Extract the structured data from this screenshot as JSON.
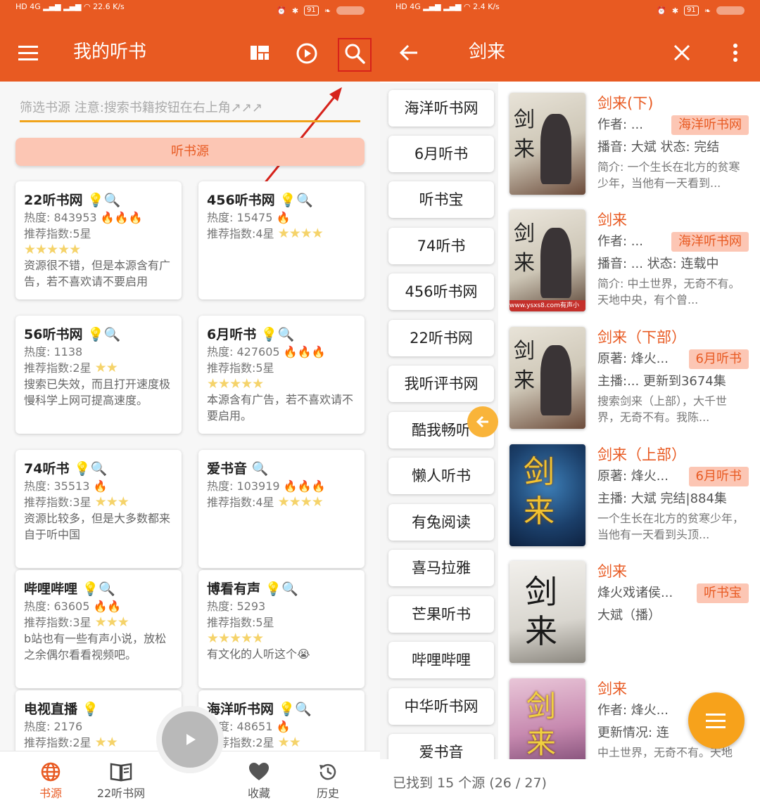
{
  "status_left": {
    "net1": "HD 4G",
    "net2": "HD 4G",
    "speed_left": "22.6",
    "speed_right": "2.4",
    "unit": "K/s"
  },
  "status_right": {
    "battery": "91"
  },
  "left": {
    "title": "我的听书",
    "filter_placeholder": "筛选书源 注意:搜索书籍按钮在右上角↗↗↗",
    "source_button": "听书源",
    "cards": [
      {
        "name": "22听书网",
        "heat": "热度: 843953",
        "rec": "推荐指数:5星",
        "stars": "★★★★★",
        "desc": "资源很不错，但是本源含有广告，若不喜欢请不要启用"
      },
      {
        "name": "456听书网",
        "heat": "热度: 15475",
        "rec": "推荐指数:4星",
        "stars": "★★★★",
        "desc": ""
      },
      {
        "name": "56听书网",
        "heat": "热度: 1138",
        "rec": "推荐指数:2星",
        "stars": "★★",
        "desc": "搜索已失效，而且打开速度极慢科学上网可提高速度。"
      },
      {
        "name": "6月听书",
        "heat": "热度: 427605",
        "rec": "推荐指数:5星",
        "stars": "★★★★★",
        "desc": "本源含有广告，若不喜欢请不要启用。"
      },
      {
        "name": "74听书",
        "heat": "热度: 35513",
        "rec": "推荐指数:3星",
        "stars": "★★★",
        "desc": "资源比较多，但是大多数都来自于听中国"
      },
      {
        "name": "爱书音",
        "heat": "热度: 103919",
        "rec": "推荐指数:4星",
        "stars": "★★★★",
        "desc": ""
      },
      {
        "name": "哔哩哔哩",
        "heat": "热度: 63605",
        "rec": "推荐指数:3星",
        "stars": "★★★",
        "desc": "b站也有一些有声小说，放松之余偶尔看看视频吧。"
      },
      {
        "name": "博看有声",
        "heat": "热度: 5293",
        "rec": "推荐指数:5星",
        "stars": "★★★★★",
        "desc": "有文化的人听这个😭"
      },
      {
        "name": "电视直播",
        "heat": "热度: 2176",
        "rec": "推荐指数:2星",
        "stars": "★★",
        "desc": ""
      },
      {
        "name": "海洋听书网",
        "heat": "热度: 48651",
        "rec": "推荐指数:2星",
        "stars": "★★",
        "desc": ""
      }
    ],
    "nav": [
      {
        "label": "书源",
        "icon": "globe-icon"
      },
      {
        "label": "22听书网",
        "icon": "book-icon"
      },
      {
        "label": "收藏",
        "icon": "heart-icon"
      },
      {
        "label": "历史",
        "icon": "history-icon"
      }
    ]
  },
  "right": {
    "title": "剑来",
    "sources": [
      "海洋听书网",
      "6月听书",
      "听书宝",
      "74听书",
      "456听书网",
      "22听书网",
      "我听评书网",
      "酷我畅听",
      "懒人听书",
      "有兔阅读",
      "喜马拉雅",
      "芒果听书",
      "哔哩哔哩",
      "中华听书网",
      "爱书音"
    ],
    "books": [
      {
        "title": "剑来(下)",
        "line1": "作者: ...",
        "tag": "海洋听书网",
        "line2": "播音: 大斌   状态:  完结",
        "desc": "简介:  一个生长在北方的贫寒少年，当他有一天看到..."
      },
      {
        "title": "剑来",
        "line1": "作者: ...",
        "tag": "海洋听书网",
        "line2": "播音: ...   状态:  连载中",
        "desc": "简介:  中土世界，无奇不有。天地中央，有个曾..."
      },
      {
        "title": "剑来（下部）",
        "line1": "原著: 烽火...",
        "tag": "6月听书",
        "line2": "主播:...   更新到3674集",
        "desc": "搜索剑来（上部），大千世界，无奇不有。我陈..."
      },
      {
        "title": "剑来（上部）",
        "line1": "原著: 烽火...",
        "tag": "6月听书",
        "line2": "主播: 大斌   完结|884集",
        "desc": "一个生长在北方的贫寒少年，当他有一天看到头顶..."
      },
      {
        "title": "剑来",
        "line1": "烽火戏诸侯...",
        "tag": "听书宝",
        "line2": "大斌（播）",
        "desc": ""
      },
      {
        "title": "剑来",
        "line1": "作者: 烽火...",
        "tag": "",
        "line2": "  更新情况: 连",
        "desc": "中土世界，无奇不有。天地"
      }
    ],
    "footer": "已找到 15 个源 (26 / 27)",
    "cover_text": "剑来",
    "cover_watermark": "www.ysxs8.com有声小"
  }
}
